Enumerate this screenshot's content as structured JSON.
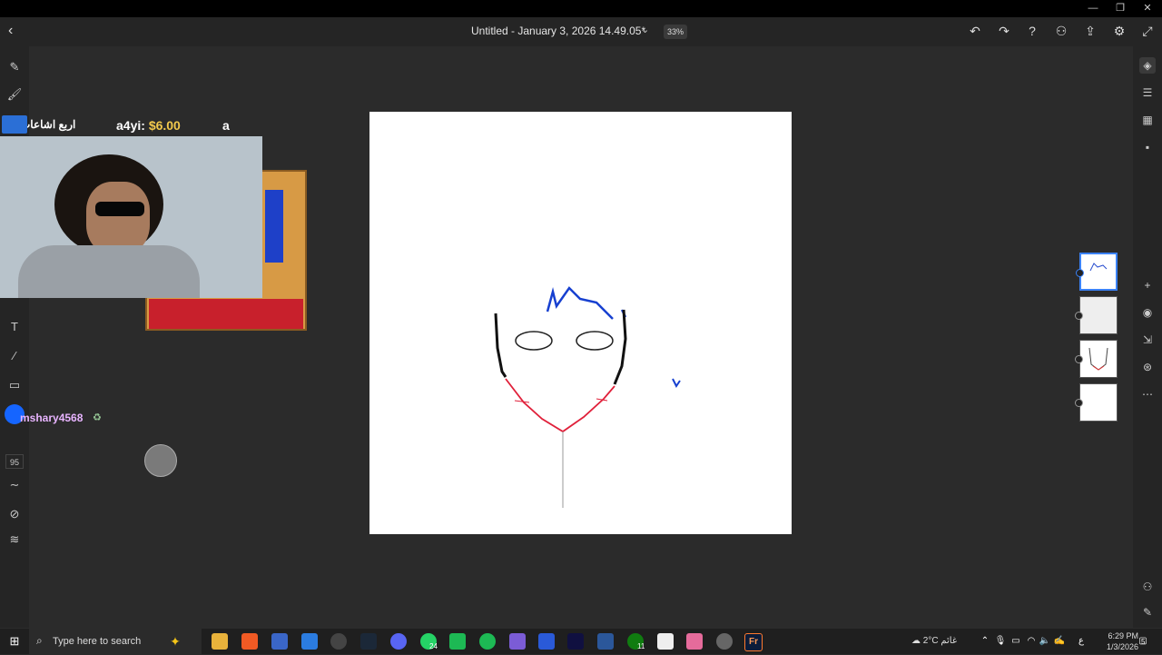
{
  "window": {
    "minimize": "—",
    "maximize": "❐",
    "close": "✕"
  },
  "appbar": {
    "title": "Untitled - January 3, 2026 14.49.05*",
    "zoom": "33%"
  },
  "stream_overlay": {
    "ticker_left": "اربع اشاعات",
    "donor": "a4yi:",
    "amount": "$6.00",
    "ticker_right": "a",
    "chat_username": "mshary4568"
  },
  "tools": {
    "brush_size": "95"
  },
  "taskbar": {
    "search_placeholder": "Type here to search",
    "weather": "2°C غائم",
    "time": "6:29 PM",
    "date": "1/3/2026",
    "whatsapp_badge": "24",
    "xbox_badge": "11",
    "language": "ع",
    "notifications": "5"
  }
}
